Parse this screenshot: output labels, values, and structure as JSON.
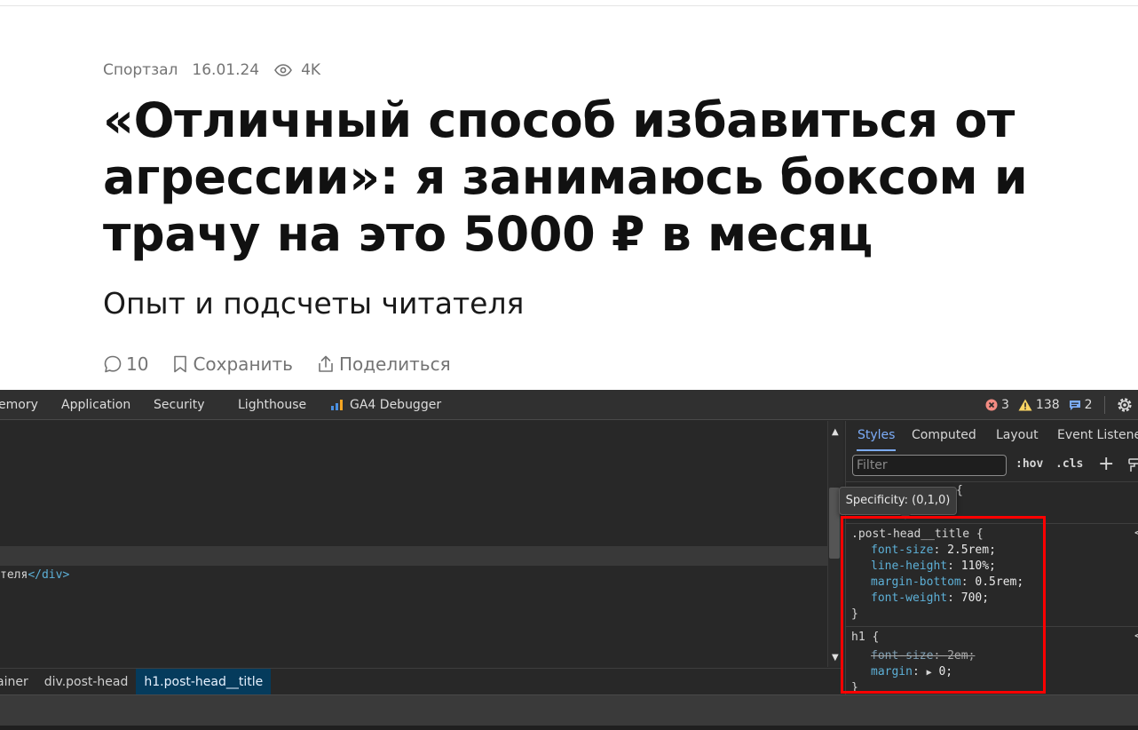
{
  "article": {
    "rubric": "Спортзал",
    "date": "16.01.24",
    "views": "4K",
    "title_lines": [
      "«Отличный способ избавиться от",
      "агрессии»: я занимаюсь боксом и",
      "трачу на это 5000 ₽ в месяц"
    ],
    "subtitle": "Опыт и подсчеты читателя",
    "comments_count": "10",
    "save_label": "Сохранить",
    "share_label": "Поделиться"
  },
  "devtools": {
    "tabs": [
      "emory",
      "Application",
      "Security",
      "Lighthouse",
      "GA4 Debugger"
    ],
    "errors": "3",
    "warnings": "138",
    "messages": "2",
    "elements_line_text": "теля",
    "elements_line_close": "</div>",
    "breadcrumbs": [
      "ainer",
      "div.post-head",
      "h1.post-head__title"
    ],
    "styles_panel": {
      "tabs": [
        "Styles",
        "Computed",
        "Layout",
        "Event Listener"
      ],
      "filter_placeholder": "Filter",
      "hov": ":hov",
      "cls": ".cls",
      "hidden_rule_brace": "{",
      "tooltip": "Specificity: (0,1,0)",
      "rule1": {
        "selector": ".post-head__title {",
        "decls": [
          {
            "prop": "font-size",
            "value": "2.5rem;"
          },
          {
            "prop": "line-height",
            "value": "110%;"
          },
          {
            "prop": "margin-bottom",
            "value": "0.5rem;"
          },
          {
            "prop": "font-weight",
            "value": "700;"
          }
        ],
        "close": "}"
      },
      "rule2": {
        "selector": "h1 {",
        "decl_struck": {
          "prop": "font-size",
          "value": "2em;"
        },
        "decl_margin": {
          "prop": "margin",
          "value": "0;"
        },
        "close": "}"
      },
      "edge_char": "<"
    }
  },
  "colors": {
    "accent": "#7cacf8",
    "highlight_box": "#ff0000",
    "error": "#f28b82",
    "warning": "#fdd663",
    "info": "#7cacf8"
  }
}
